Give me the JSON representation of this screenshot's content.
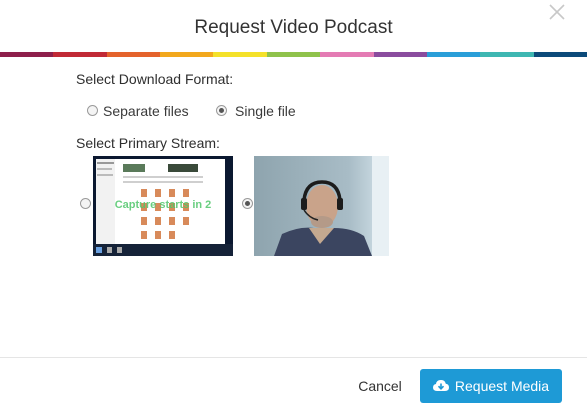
{
  "modal": {
    "title": "Request Video Podcast",
    "close_icon": "close-icon"
  },
  "stripe_colors": [
    "#8e1f4b",
    "#c12a36",
    "#e4632c",
    "#f2a81d",
    "#f4e12a",
    "#8fc24b",
    "#e47bb4",
    "#8a4c9e",
    "#2a9ed8",
    "#3eb7b2",
    "#0c4a7a"
  ],
  "download_format": {
    "label": "Select Download Format:",
    "options": [
      {
        "label": "Separate files",
        "selected": false
      },
      {
        "label": "Single file",
        "selected": true
      }
    ]
  },
  "primary_stream": {
    "label": "Select Primary Stream:",
    "options": [
      {
        "name": "screen-capture-stream",
        "overlay_text": "Capture starts in 2",
        "selected": false
      },
      {
        "name": "camera-stream",
        "selected": true
      }
    ]
  },
  "footer": {
    "cancel_label": "Cancel",
    "request_label": "Request Media",
    "request_icon": "cloud-download-icon",
    "request_color": "#1e9ad6"
  }
}
